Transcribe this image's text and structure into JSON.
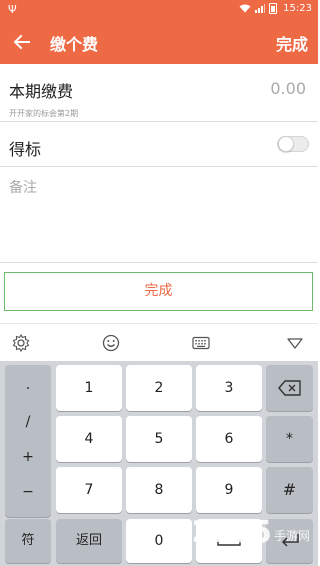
{
  "status_bar": {
    "time": "15:23"
  },
  "header": {
    "title": "缴个费",
    "done_label": "完成"
  },
  "payment": {
    "label": "本期缴费",
    "amount": "0.00",
    "subtitle": "开开家的标会第2期"
  },
  "win_bid": {
    "label": "得标",
    "enabled": false
  },
  "remark": {
    "placeholder": "备注",
    "value": ""
  },
  "confirm_button": {
    "label": "完成"
  },
  "keyboard": {
    "side_column": [
      ".",
      "/",
      "+",
      "−"
    ],
    "rows": [
      [
        "1",
        "2",
        "3"
      ],
      [
        "4",
        "5",
        "6"
      ],
      [
        "7",
        "8",
        "9"
      ]
    ],
    "right_column": [
      "⌫",
      "*",
      "#"
    ],
    "bottom": {
      "symbol": "符",
      "back": "返回",
      "zero": "0",
      "space": "␣",
      "enter": "↵"
    }
  },
  "watermark": {
    "number": "2265",
    "text": "手游网"
  }
}
